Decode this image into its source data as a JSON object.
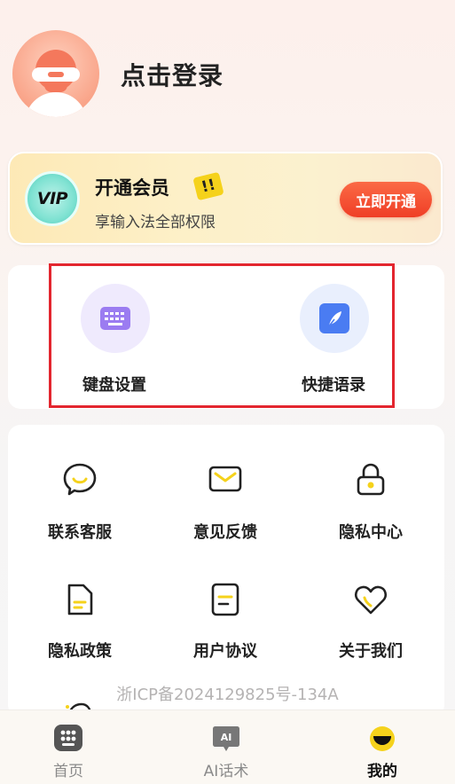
{
  "header": {
    "login_label": "点击登录"
  },
  "vip": {
    "badge_text": "VIP",
    "title": "开通会员",
    "exclaim": "!!",
    "subtitle": "享输入法全部权限",
    "button_label": "立即开通"
  },
  "shortcuts": [
    {
      "label": "键盘设置",
      "icon": "keyboard-icon"
    },
    {
      "label": "快捷语录",
      "icon": "feather-icon"
    }
  ],
  "menu": [
    {
      "label": "联系客服",
      "icon": "chat-bubble-icon"
    },
    {
      "label": "意见反馈",
      "icon": "envelope-icon"
    },
    {
      "label": "隐私中心",
      "icon": "lock-icon"
    },
    {
      "label": "隐私政策",
      "icon": "document-icon"
    },
    {
      "label": "用户协议",
      "icon": "agreement-icon"
    },
    {
      "label": "关于我们",
      "icon": "heart-icon"
    }
  ],
  "icp": "浙ICP备2024129825号-134A",
  "tabbar": {
    "items": [
      {
        "label": "首页",
        "icon": "home-keypad-icon",
        "active": false
      },
      {
        "label": "AI话术",
        "icon": "ai-chat-icon",
        "active": false
      },
      {
        "label": "我的",
        "icon": "profile-face-icon",
        "active": true
      }
    ]
  },
  "colors": {
    "accent": "#f5d21b",
    "vip_button": "#ef3e26",
    "highlight_frame": "#e3262f",
    "keyboard_icon": "#9b7cf1",
    "feather_icon": "#4a7cf2"
  }
}
